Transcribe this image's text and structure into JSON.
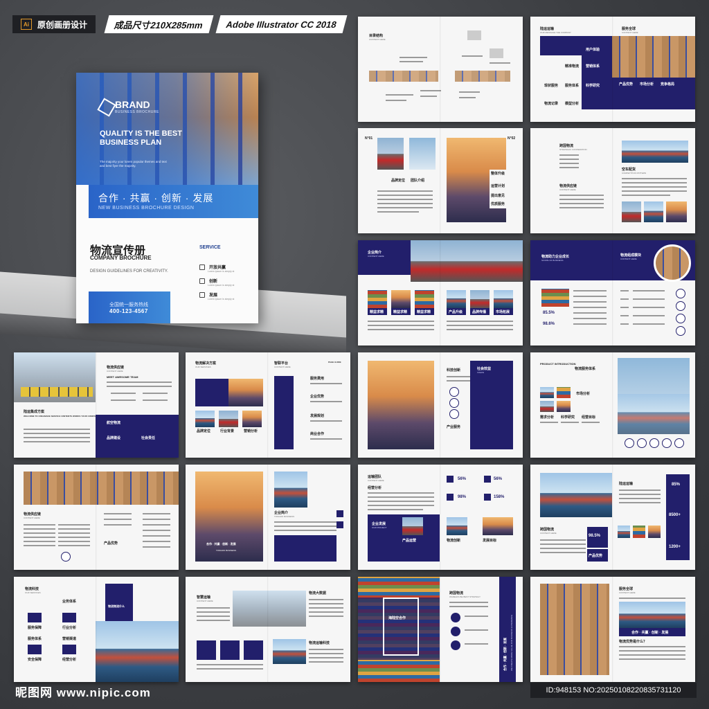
{
  "tags": {
    "ai_badge": "Ai",
    "design_name": "原创画册设计",
    "size": "成品尺寸210X285mm",
    "software": "Adobe Illustrator CC 2018"
  },
  "cover": {
    "brand": "BRAND",
    "brand_sub": "BUSINESS BROCHURE",
    "quality": "QUALITY IS THE BEST BUSINESS PLAN",
    "blurb": "The majority your lorem popular themes and text and best fiyer the majority.",
    "slogan": "合作 · 共赢 · 创新 · 发展",
    "slogan_en": "NEW BUSINESS  BROCHURE DESIGN",
    "title_cn": "物流宣传册",
    "title_en": "COMPANY BROCHURE",
    "guidelines": "DESIGN GUIDELINES FOR CREATIVITY.",
    "service_label": "SERVICE",
    "services": [
      {
        "name": "开放共赢",
        "sub": "Lorem ipsum is simply st"
      },
      {
        "name": "创新",
        "sub": "Lorem ipsum is simply st"
      },
      {
        "name": "发展",
        "sub": "Lorem ipsum is simply st"
      }
    ],
    "hotline": "全国统一服务热线",
    "phone": "400-123-4567"
  },
  "spreads": {
    "r1a": {
      "t1": "目录结构",
      "s1": "CONTENT HERE"
    },
    "r1b": {
      "t1": "陆运运输",
      "s1": "OUR MESSAGE THE COMPANY",
      "t2": "服务全球",
      "s2": "CONTENT HERE",
      "i1": "用户体验",
      "i2": "精准物流",
      "i3": "营销体系",
      "i4": "现状服务",
      "i5": "科学研究",
      "i6": "产品优势",
      "i7": "市场分析",
      "i8": "竞争格局",
      "i9": "服务体系",
      "i10": "物流记录",
      "i11": "模型分析"
    },
    "r2a": {
      "n1": "N°01",
      "n2": "N°02",
      "t1": "品牌定位",
      "t2": "团队介绍",
      "t3": "整体升级",
      "t4": "运营计划",
      "t5": "提出意见",
      "t6": "优质服务"
    },
    "r2b": {
      "t1": "跨国物流",
      "s1": "STRATEGIC COOPERATION",
      "t2": "物流供应链",
      "s2": "CONTENT HERE",
      "t3": "空车配货",
      "s3": "COMPETITION PATTERN"
    },
    "r3a": {
      "t1": "企业简介",
      "s1": "CONTENT HERE",
      "c1": "精益求精",
      "c2": "精益求精",
      "c3": "精益求精",
      "c4": "产品升级",
      "c5": "品牌传播",
      "c6": "市场拓展"
    },
    "r3b": {
      "t1": "物流助力企业成长",
      "s1": "SCOPE OF BUSINESS",
      "t2": "物流组成模块",
      "s2": "CONTENT HERE",
      "p1": "85.5%",
      "p2": "98.6%"
    },
    "r4a": {
      "t1": "物流供应链",
      "s1": "CONTENT HERE",
      "t2": "MEET AWESOME TEAM",
      "t3": "陆运集成方案",
      "s3": "WELCOME TO CREAMAKE SERVICE CONTENTS WORKS YOUR COMPANY",
      "t4": "航空物流",
      "b1": "品牌建设",
      "b2": "社会责任"
    },
    "r4b": {
      "t1": "物流解决方案",
      "s1": "OUR SERVICES",
      "t2": "智联平台",
      "s2": "CONTENT HERE",
      "t3": "PAGE GUIDE",
      "c1": "品牌定位",
      "c2": "行业背景",
      "c3": "营销分析",
      "l1": "服务费用",
      "l2": "企业优势",
      "l3": "发展规划",
      "l4": "商业合作"
    },
    "r5a": {
      "t1": "科技创新",
      "t2": "社会效益",
      "s2": "VISION",
      "t3": "产业服务"
    },
    "r5b": {
      "t1": "PRODUCT INTRODUCTION",
      "t2": "物流服务体系",
      "c1": "市场分析",
      "c2": "需求分析",
      "c3": "科学研究",
      "c4": "经营目标"
    },
    "r6a": {
      "t1": "物流供应链",
      "s1": "CONTENT HERE",
      "t2": "产品优势"
    },
    "r6b": {
      "t1": "企业简介",
      "s1": "TONGRO BUSINESS",
      "o1": "TONGRO BUSINESS",
      "o2": "合作 · 共赢 · 创新 · 发展"
    },
    "r7a": {
      "t1": "运输团队",
      "s1": "CONTENT HERE",
      "t2": "经营分析",
      "t3": "企业发展",
      "s3": "OUR PROJECT",
      "t4": "产品运营",
      "t5": "物流创新",
      "t6": "发展目标",
      "p1": "56%",
      "p2": "56%",
      "p3": "98%",
      "p4": "158%"
    },
    "r7b": {
      "t1": "陆运运输",
      "t2": "跨国物流",
      "s2": "CONTENT HERE",
      "p1": "98.5%",
      "n1": "85%",
      "n2": "8500+",
      "n3": "1200+",
      "t3": "产品优势"
    },
    "r8a": {
      "t1": "物流科技",
      "s1": "OUR SERVICES",
      "t2": "业务体系",
      "t3": "物流物流什么",
      "c1": "服务保障",
      "c2": "行业分析",
      "c3": "服务体系",
      "c4": "营销渠道",
      "c5": "安全保障",
      "c6": "经营分析"
    },
    "r8b": {
      "t1": "智慧运输",
      "s1": "CONTENT HERE",
      "t2": "物流大数据",
      "t3": "物流运输科技"
    },
    "r9a": {
      "t1": "海陆空合作",
      "t2": "跨国物流",
      "s2": "WAREHOUSE BEST STRATEGY",
      "v1": "合作 · 共赢 · 创新 · 发展",
      "v2": "WE CREATE MORE VALUE FOR BUSINESS EXPERIENCE"
    },
    "r9b": {
      "t1": "服务全球",
      "s1": "CONTENT HERE",
      "o1": "合作 · 共赢 · 创新 · 发展",
      "t2": "物流优势是什么？"
    }
  },
  "footer": {
    "watermark": "昵图网 www.nipic.com",
    "id": "ID:948153 NO:20250108220835731120"
  }
}
